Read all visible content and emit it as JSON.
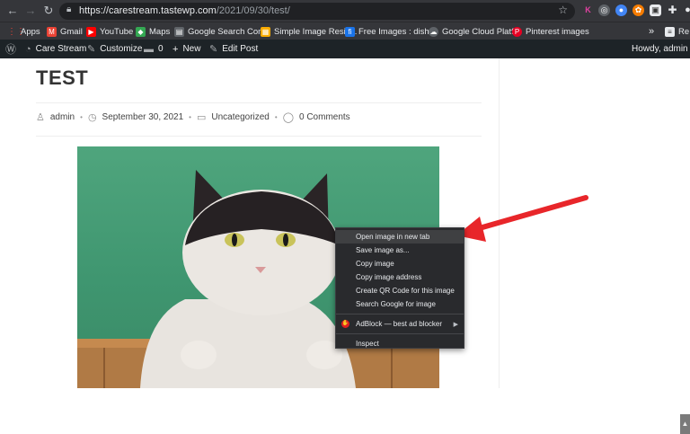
{
  "browser": {
    "url_host": "https://carestream.tastewp.com",
    "url_path": "/2021/09/30/test/",
    "bookmarks": [
      {
        "label": "Apps",
        "icon": "apps-grid-icon",
        "color": "#ea4335"
      },
      {
        "label": "Gmail",
        "icon": "gmail-icon",
        "color": "#ea4335"
      },
      {
        "label": "YouTube",
        "icon": "youtube-icon",
        "color": "#ff0000"
      },
      {
        "label": "Maps",
        "icon": "maps-icon",
        "color": "#34a853"
      },
      {
        "label": "Google Search Con...",
        "icon": "search-console-icon",
        "color": "#5f6368"
      },
      {
        "label": "Simple Image Resiz...",
        "icon": "image-resizer-icon",
        "color": "#f9ab00"
      },
      {
        "label": "Free Images : dish,...",
        "icon": "freeimages-icon",
        "color": "#1a73e8"
      },
      {
        "label": "Google Cloud Platf...",
        "icon": "cloud-icon",
        "color": "#5f6368"
      },
      {
        "label": "Pinterest images",
        "icon": "pinterest-icon",
        "color": "#e60023"
      }
    ],
    "more_bookmarks": "»",
    "reading_list": "Re"
  },
  "admin_bar": {
    "site_name": "Care Stream",
    "customize": "Customize",
    "comments_count": "0",
    "new_label": "New",
    "edit_post": "Edit Post",
    "howdy": "Howdy, admin"
  },
  "post": {
    "title": "TEST",
    "author": "admin",
    "date": "September 30, 2021",
    "category": "Uncategorized",
    "comments": "0 Comments"
  },
  "context_menu": {
    "items": [
      {
        "label": "Open image in new tab",
        "highlighted": true
      },
      {
        "label": "Save image as..."
      },
      {
        "label": "Copy image"
      },
      {
        "label": "Copy image address"
      },
      {
        "label": "Create QR Code for this image"
      },
      {
        "label": "Search Google for image"
      },
      {
        "label": "AdBlock — best ad blocker",
        "submenu": true
      },
      {
        "label": "Inspect"
      }
    ]
  },
  "colors": {
    "annotation_arrow": "#e8262a",
    "admin_bar": "#1d2327",
    "browser_chrome": "#35363a"
  }
}
